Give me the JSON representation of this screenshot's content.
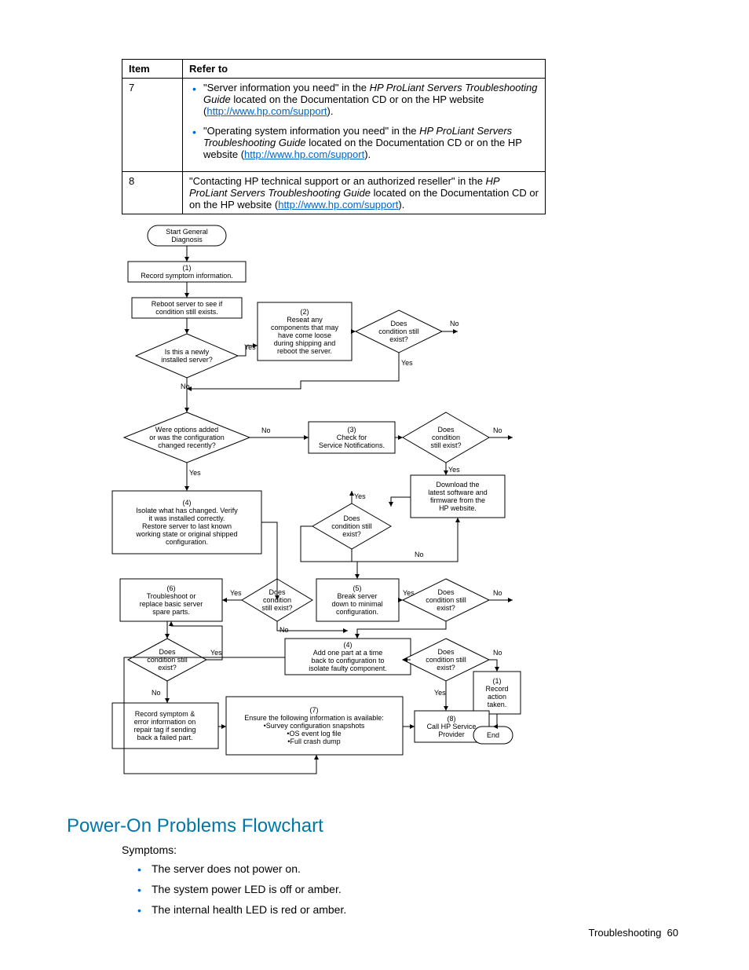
{
  "table": {
    "headers": {
      "item": "Item",
      "refer": "Refer to"
    },
    "rows": [
      {
        "item": "7",
        "bullets": [
          {
            "pre": "\"Server information you need\" in the ",
            "italic": "HP ProLiant Servers Troubleshooting Guide",
            "post1": " located on the Documentation CD or on the HP website (",
            "link": "http://www.hp.com/support",
            "post2": ")."
          },
          {
            "pre": "\"Operating system information you need\" in the ",
            "italic": "HP ProLiant Servers Troubleshooting Guide",
            "post1": " located on the Documentation CD or on the HP website (",
            "link": "http://www.hp.com/support",
            "post2": ")."
          }
        ]
      },
      {
        "item": "8",
        "plain": {
          "pre": "\"Contacting HP technical support or an authorized reseller\" in the ",
          "italic": "HP ProLiant Servers Troubleshooting Guide",
          "post1": " located on the Documentation CD or on the HP website (",
          "link": "http://www.hp.com/support",
          "post2": ")."
        }
      }
    ]
  },
  "flow": {
    "start": "Start General\nDiagnosis",
    "n1": "(1)\nRecord symptom information.",
    "n_reboot": "Reboot server to see if\ncondition still exists.",
    "d_new": "Is this a newly\ninstalled server?",
    "n2": "(2)\nReseat any\ncomponents that may\nhave come loose\nduring shipping and\nreboot the server.",
    "d_cond1": "Does\ncondition still\nexist?",
    "d_opts": "Were options added\nor was the configuration\nchanged recently?",
    "n3": "(3)\nCheck for\nService Notifications.",
    "d_cond2": "Does\ncondition\nstill exist?",
    "n_dl": "Download the\nlatest software and\nfirmware from the\nHP website.",
    "n4": "(4)\nIsolate what has changed. Verify\nit was installed correctly.\nRestore server to last known\nworking state or original shipped\nconfiguration.",
    "d_cond3": "Does\ncondition still\nexist?",
    "n5": "(5)\nBreak server\ndown to minimal\nconfiguration.",
    "d_cond4": "Does\ncondition still\nexist?",
    "n6": "(6)\nTroubleshoot or\nreplace basic server\nspare parts.",
    "d_cond5": "Does\ncondition\nstill exist?",
    "n4b": "(4)\nAdd one part at a time\nback to configuration to\nisolate faulty component.",
    "d_cond6": "Does\ncondition still\nexist?",
    "n1b": "(1)\nRecord\naction\ntaken.",
    "d_cond7": "Does\ncondition still\nexist?",
    "n_rec": "Record symptom &\nerror information on\nrepair tag if sending\nback a failed part.",
    "n7": "(7)\nEnsure the following information is available:\n•Survey configuration snapshots\n•OS event log file\n•Full crash dump",
    "n8": "(8)\nCall HP Service\nProvider",
    "end": "End",
    "yes": "Yes",
    "no": "No"
  },
  "section_title": "Power-On Problems Flowchart",
  "symptoms_label": "Symptoms:",
  "symptoms": [
    "The server does not power on.",
    "The system power LED is off or amber.",
    "The internal health LED is red or amber."
  ],
  "footer": {
    "label": "Troubleshooting",
    "page": "60"
  }
}
